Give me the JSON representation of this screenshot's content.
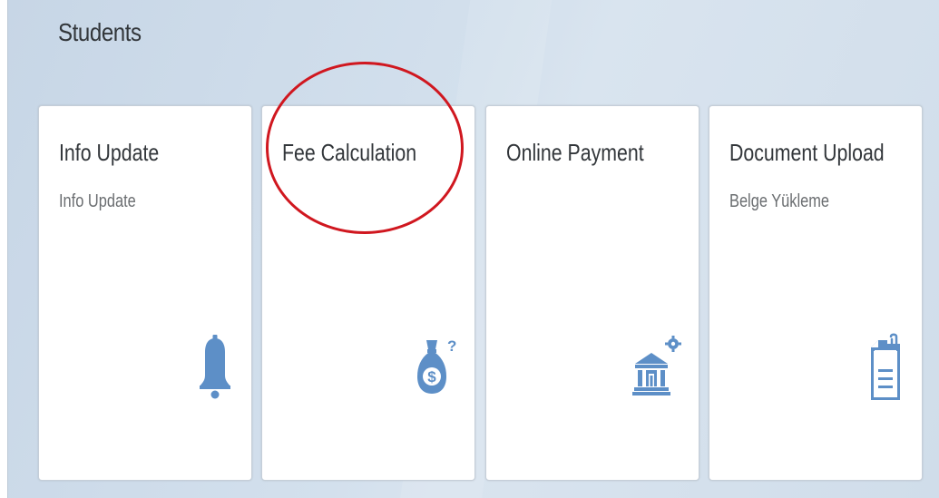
{
  "group": {
    "title": "Students"
  },
  "tiles": [
    {
      "title": "Info Update",
      "subtitle": "Info Update",
      "icon": "bell-icon"
    },
    {
      "title": "Fee Calculation",
      "subtitle": "",
      "icon": "money-bag-question-icon"
    },
    {
      "title": "Online Payment",
      "subtitle": "",
      "icon": "bank-settings-icon"
    },
    {
      "title": "Document Upload",
      "subtitle": "Belge Yükleme",
      "icon": "document-attachment-icon"
    }
  ],
  "colors": {
    "icon": "#5d8fc7",
    "annotation": "#d0171f",
    "group_background": "#cfdbe8",
    "tile_background": "#ffffff",
    "title_text": "#32363a",
    "subtitle_text": "#6a6d70"
  }
}
